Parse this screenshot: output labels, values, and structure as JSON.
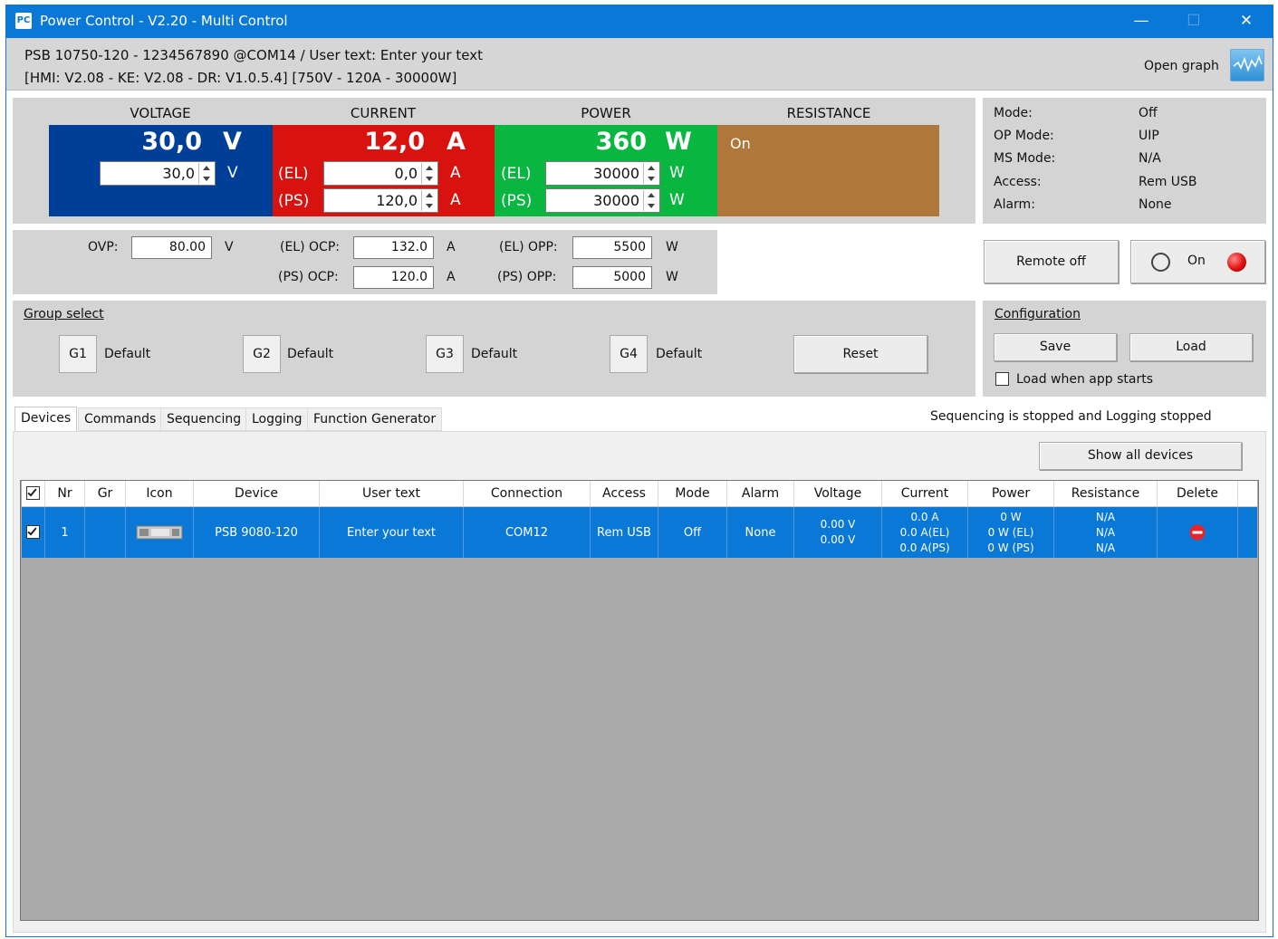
{
  "window": {
    "app_icon": "PC",
    "title": "Power Control - V2.20 - Multi Control",
    "minimize_glyph": "—",
    "maximize_glyph": "☐",
    "close_glyph": "✕"
  },
  "header": {
    "line1": "PSB 10750-120 - 1234567890 @COM14 / User text: Enter your text",
    "line2": "[HMI: V2.08 - KE: V2.08 - DR: V1.0.5.4] [750V - 120A - 30000W]",
    "open_graph_label": "Open graph",
    "open_graph_icon": "graph-icon"
  },
  "values": {
    "voltage": {
      "heading": "VOLTAGE",
      "actual": "30,0",
      "unit": "V",
      "set": "30,0",
      "set_unit": "V",
      "color": "#003f97"
    },
    "current": {
      "heading": "CURRENT",
      "actual": "12,0",
      "unit": "A",
      "el_label": "(EL)",
      "el_set": "0,0",
      "el_unit": "A",
      "ps_label": "(PS)",
      "ps_set": "120,0",
      "ps_unit": "A",
      "color": "#d8120f"
    },
    "power": {
      "heading": "POWER",
      "actual": "360",
      "unit": "W",
      "el_label": "(EL)",
      "el_set": "30000",
      "el_unit": "W",
      "ps_label": "(PS)",
      "ps_set": "30000",
      "ps_unit": "W",
      "color": "#08b640"
    },
    "resistance": {
      "heading": "RESISTANCE",
      "state": "On",
      "color": "#b0773a"
    }
  },
  "status": {
    "mode_label": "Mode:",
    "mode_value": "Off",
    "op_mode_label": "OP Mode:",
    "op_mode_value": "UIP",
    "ms_mode_label": "MS Mode:",
    "ms_mode_value": "N/A",
    "access_label": "Access:",
    "access_value": "Rem USB",
    "alarm_label": "Alarm:",
    "alarm_value": "None"
  },
  "protection": {
    "ovp_label": "OVP:",
    "ovp_value": "80.00",
    "ovp_unit": "V",
    "el_ocp_label": "(EL) OCP:",
    "el_ocp_value": "132.0",
    "el_ocp_unit": "A",
    "ps_ocp_label": "(PS) OCP:",
    "ps_ocp_value": "120.0",
    "ps_ocp_unit": "A",
    "el_opp_label": "(EL) OPP:",
    "el_opp_value": "5500",
    "el_opp_unit": "W",
    "ps_opp_label": "(PS) OPP:",
    "ps_opp_value": "5000",
    "ps_opp_unit": "W"
  },
  "controls": {
    "remote_button": "Remote off",
    "output_label": "On",
    "output_led_color": "#e01010"
  },
  "groups": {
    "title": "Group select",
    "items": [
      {
        "button": "G1",
        "name": "Default"
      },
      {
        "button": "G2",
        "name": "Default"
      },
      {
        "button": "G3",
        "name": "Default"
      },
      {
        "button": "G4",
        "name": "Default"
      }
    ],
    "reset_label": "Reset"
  },
  "configuration": {
    "title": "Configuration",
    "save_label": "Save",
    "load_label": "Load",
    "autoload_label": "Load when app starts",
    "autoload_checked": false
  },
  "tabs": [
    "Devices",
    "Commands",
    "Sequencing",
    "Logging",
    "Function Generator"
  ],
  "active_tab": "Devices",
  "status_message": "Sequencing is stopped and Logging stopped",
  "show_all_label": "Show all devices",
  "table": {
    "columns": [
      "Nr",
      "Gr",
      "Icon",
      "Device",
      "User text",
      "Connection",
      "Access",
      "Mode",
      "Alarm",
      "Voltage",
      "Current",
      "Power",
      "Resistance",
      "Delete"
    ],
    "rows": [
      {
        "checked": true,
        "nr": "1",
        "gr": "",
        "icon": "device-icon",
        "device": "PSB 9080-120",
        "user_text": "Enter your text",
        "connection": "COM12",
        "access": "Rem USB",
        "mode": "Off",
        "alarm": "None",
        "voltage": [
          "0.00 V",
          "0.00 V"
        ],
        "current": [
          "0.0 A",
          "0.0 A(EL)",
          "0.0 A(PS)"
        ],
        "power": [
          "0 W",
          "0 W (EL)",
          "0 W (PS)"
        ],
        "resistance": [
          "N/A",
          "N/A",
          "N/A"
        ],
        "delete_icon": "delete-icon"
      }
    ]
  }
}
